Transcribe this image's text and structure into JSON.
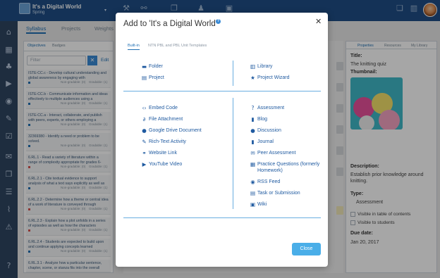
{
  "topbar": {
    "app_title": "It's a Digital World",
    "app_subtitle": "Spring",
    "icons": [
      {
        "name": "wrench-icon",
        "glyph": "🔧",
        "label": ""
      },
      {
        "name": "link-icon",
        "glyph": "⚯",
        "label": ""
      },
      {
        "name": "copy-icon",
        "glyph": "❐",
        "label": ""
      },
      {
        "name": "person-icon",
        "glyph": "♟",
        "label": ""
      },
      {
        "name": "archive-icon",
        "glyph": "▣",
        "label": ""
      },
      {
        "name": "duplicate-icon",
        "glyph": "❏",
        "label": ""
      },
      {
        "name": "chart-icon",
        "glyph": "▥",
        "label": ""
      }
    ]
  },
  "leftnav": {
    "items": [
      "home-icon",
      "calendar-icon",
      "users-icon",
      "play-icon",
      "palette-icon",
      "edit-icon",
      "check-icon",
      "mail-icon",
      "files-icon",
      "list-icon",
      "graph-icon",
      "warning-icon",
      "help-icon"
    ]
  },
  "content": {
    "tabs": [
      "Syllabus",
      "Projects",
      "Weights"
    ]
  },
  "leftpanel": {
    "tabs": [
      "Objectives",
      "Badges"
    ],
    "filter_placeholder": "Filter",
    "edit_label": "Edit",
    "standards": [
      {
        "text": "ISTE-CC.c - Develop cultural understanding and global awareness by engaging with",
        "ng": "Non-gradable: (0)",
        "gr": "Gradable: (1)",
        "dot": "blue"
      },
      {
        "text": "ISTE-CC.b - Communicate information and ideas effectively to multiple audiences using a",
        "ng": "Non-gradable: (0)",
        "gr": "Gradable: (1)",
        "dot": "blue"
      },
      {
        "text": "ISTE-CC.a - Interact, collaborate, and publish with peers, experts, or others employing a",
        "ng": "Non-gradable: (0)",
        "gr": "Gradable: (1)",
        "dot": "blue"
      },
      {
        "text": "32369380 - Identify a need or problem to be solved.",
        "ng": "Non-gradable: (0)",
        "gr": "Gradable: (1)",
        "dot": "blue"
      },
      {
        "text": "6.RL.1 - Read a variety of literature within a range of complexity appropriate for grades 6-",
        "ng": "Non-gradable: (0)",
        "gr": "Gradable: (1)",
        "dot": "red"
      },
      {
        "text": "6.RL.2.1 - Cite textual evidence to support analysis of what a text says explicitly as well as",
        "ng": "Non-gradable: (0)",
        "gr": "Gradable: (1)",
        "dot": "blue"
      },
      {
        "text": "6.RL.2.2 - Determine how a theme or central idea of a work of literature is conveyed through",
        "ng": "Non-gradable: (0)",
        "gr": "Gradable: (1)",
        "dot": "red"
      },
      {
        "text": "6.RL.2.3 - Explain how a plot unfolds in a series of episodes as well as how the characters",
        "ng": "Non-gradable: (0)",
        "gr": "Gradable: (1)",
        "dot": "red"
      },
      {
        "text": "6.RL.2.4 - Students are expected to build upon and continue applying concepts learned",
        "ng": "Non-gradable: (0)",
        "gr": "Gradable: (1)",
        "dot": "blue"
      },
      {
        "text": "6.RL.3.1 - Analyze how a particular sentence, chapter, scene, or stanza fits into the overall",
        "ng": "",
        "gr": "",
        "dot": ""
      }
    ]
  },
  "rightpanel": {
    "tabs": [
      "Properties",
      "Resources",
      "My Library"
    ],
    "title_label": "Title:",
    "title_value": "The knitting quiz",
    "thumbnail_label": "Thumbnail:",
    "description_label": "Description:",
    "description_value": "Establish prior knowledge around knitting.",
    "type_label": "Type:",
    "type_value": "Assessment",
    "check1": "Visible in table of contents",
    "check2": "Visible to students",
    "due_label": "Due date:",
    "due_value": "Jan 20, 2017"
  },
  "modal": {
    "title": "Add to 'It's a Digital World'",
    "tabs": [
      "Built-in",
      "NTN PBL and PBL Unit Templates"
    ],
    "section1_left": [
      {
        "icon": "folder-icon",
        "glyph": "▬",
        "label": "Folder"
      },
      {
        "icon": "project-icon",
        "glyph": "▤",
        "label": "Project"
      }
    ],
    "section1_right": [
      {
        "icon": "library-icon",
        "glyph": "▥",
        "label": "Library"
      },
      {
        "icon": "wizard-icon",
        "glyph": "★",
        "label": "Project Wizard"
      }
    ],
    "section2_left": [
      {
        "icon": "embed-code-icon",
        "glyph": "‹›",
        "label": "Embed Code"
      },
      {
        "icon": "file-attachment-icon",
        "glyph": "⌀",
        "label": "File Attachment"
      },
      {
        "icon": "google-drive-icon",
        "glyph": "●",
        "label": "Google Drive Document"
      },
      {
        "icon": "rich-text-icon",
        "glyph": "✎",
        "label": "Rich-Text Activity"
      },
      {
        "icon": "website-link-icon",
        "glyph": "⚭",
        "label": "Website Link"
      },
      {
        "icon": "youtube-icon",
        "glyph": "▶",
        "label": "YouTube Video"
      }
    ],
    "section2_right": [
      {
        "icon": "assessment-icon",
        "glyph": "?",
        "label": "Assessment"
      },
      {
        "icon": "blog-icon",
        "glyph": "▮",
        "label": "Blog"
      },
      {
        "icon": "discussion-icon",
        "glyph": "●",
        "label": "Discussion"
      },
      {
        "icon": "journal-icon",
        "glyph": "▮",
        "label": "Journal"
      },
      {
        "icon": "peer-assessment-icon",
        "glyph": "✉",
        "label": "Peer Assessment"
      },
      {
        "icon": "practice-questions-icon",
        "glyph": "▦",
        "label": "Practice Questions (formerly Homework)"
      },
      {
        "icon": "rss-feed-icon",
        "glyph": "◉",
        "label": "RSS Feed"
      },
      {
        "icon": "task-icon",
        "glyph": "▤",
        "label": "Task or Submission"
      },
      {
        "icon": "wiki-icon",
        "glyph": "▣",
        "label": "Wiki"
      }
    ],
    "close_label": "Close"
  },
  "colors": {
    "brand": "#1f4e86",
    "accent": "#4aaee8",
    "link": "#1f5aa0"
  }
}
